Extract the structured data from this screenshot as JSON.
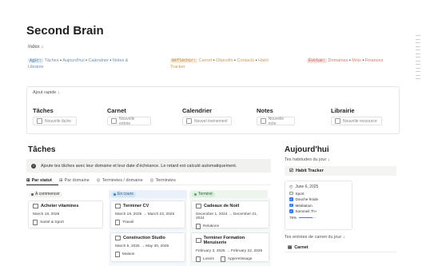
{
  "page": {
    "title": "Second Brain",
    "index": "Index ↓"
  },
  "tags": {
    "agir": {
      "label": "Agir:",
      "items": [
        "Tâches",
        "Aujourd'hui",
        "Calendrier",
        "Notes &",
        "Librairie"
      ]
    },
    "reflechir": {
      "label": "Réfléchir:",
      "items": [
        "Carnet",
        "Objectifs",
        "Contacts",
        "Habit",
        "Tracker"
      ]
    },
    "evoluer": {
      "label": "Évolue:",
      "items": [
        "Domaines",
        "Mois",
        "Finances"
      ]
    }
  },
  "quick_add": {
    "title": "Ajout rapide ↓",
    "columns": [
      {
        "title": "Tâches",
        "button": "Nouvelle tâche"
      },
      {
        "title": "Carnet",
        "button": "Nouvelle entrée"
      },
      {
        "title": "Calendrier",
        "button": "Nouvel événement"
      },
      {
        "title": "Notes",
        "button": "Nouvelle note"
      },
      {
        "title": "Librairie",
        "button": "Nouvelle ressource"
      }
    ]
  },
  "tasks": {
    "title": "Tâches",
    "info": "Ajoute tes tâches avec leur domaine et leur date d'échéance. Le retard est calculé automatiquement.",
    "tabs": [
      "Par statut",
      "Par domaine",
      "Terminées / domaine",
      "Terminées"
    ],
    "columns": [
      {
        "status": "À commencer",
        "color": "#f1f1ef",
        "dot": "#555555",
        "cards": [
          {
            "title": "Acheter vitamines",
            "date": "March 18, 2025",
            "tags": [
              "Santé & Sport"
            ]
          }
        ]
      },
      {
        "status": "En cours",
        "color": "#d3e5f5",
        "dot": "#2f80ed",
        "cards": [
          {
            "title": "Terminer CV",
            "date": "March 19, 2025 → March 23, 2025",
            "tags": [
              "Travail"
            ]
          },
          {
            "title": "Construction Studio",
            "date": "March 5, 2025 → May 30, 2025",
            "tags": [
              "Maison"
            ]
          }
        ]
      },
      {
        "status": "Terminé",
        "color": "#dbeddb",
        "dot": "#4dab6d",
        "cards": [
          {
            "title": "Cadeaux de Noël",
            "date": "December 1, 2024 → December 21, 2024",
            "tags": [
              "Relations"
            ]
          },
          {
            "title": "Terminer Formation Menuiserie",
            "date": "February 3, 2025 → February 22, 2025",
            "tags": [
              "Loisirs",
              "Apprentissage"
            ]
          }
        ]
      }
    ]
  },
  "today": {
    "title": "Aujourd'hui",
    "habits_label": "Tes habitudes du jour ↓",
    "habit_tracker": "Habit Tracker",
    "habit_date": "June 6, 2025",
    "habits": [
      {
        "label": "Sport",
        "checked": false
      },
      {
        "label": "Douche froide",
        "checked": true
      },
      {
        "label": "Méditation",
        "checked": true
      },
      {
        "label": "Sommeil 7h+",
        "checked": true
      }
    ],
    "progress": 75,
    "progress_label": "75%",
    "journal_label": "Tes entrées de carnet du jour ↓",
    "carnet": "Carnet"
  }
}
